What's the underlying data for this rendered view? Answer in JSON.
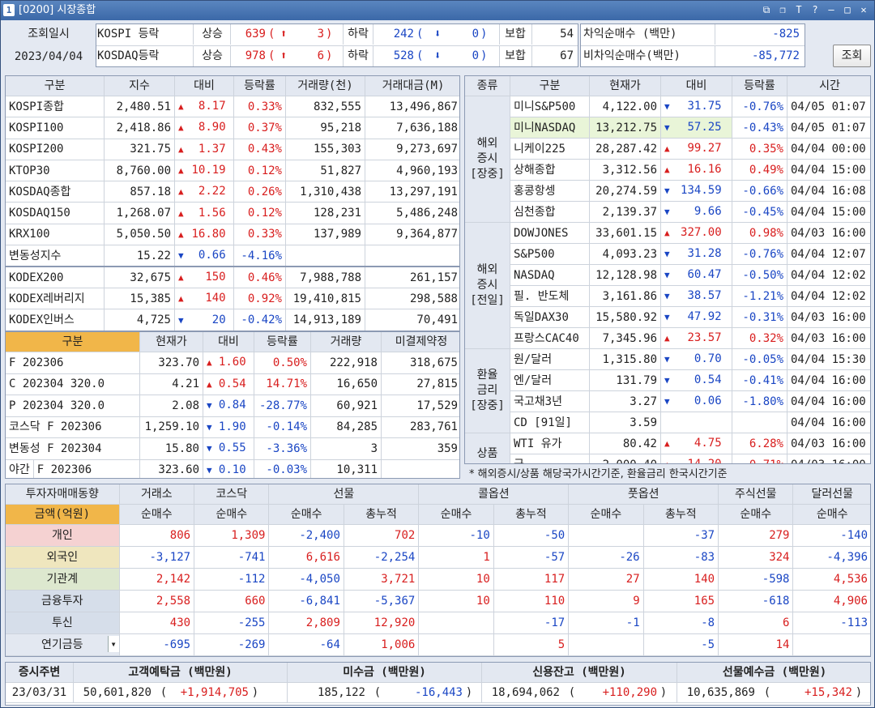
{
  "window": {
    "title": "[0200] 시장종합",
    "icon": "1"
  },
  "summary": {
    "date_label": "조회일시",
    "date": "2023/04/04",
    "kospi": {
      "label": "KOSPI 등락",
      "up_label": "상승",
      "up": "639",
      "upper": "3",
      "down_label": "하락",
      "down": "242",
      "lower": "0",
      "flat_label": "보합",
      "flat": "54"
    },
    "kosdaq": {
      "label": "KOSDAQ등락",
      "up_label": "상승",
      "up": "978",
      "upper": "6",
      "down_label": "하락",
      "down": "528",
      "lower": "0",
      "flat_label": "보합",
      "flat": "67"
    },
    "arb_label": "차익순매수  (백만)",
    "arb": "-825",
    "nonarb_label": "비차익순매수(백만)",
    "nonarb": "-85,772",
    "query_button": "조회"
  },
  "index_table": {
    "headers": [
      "구분",
      "지수",
      "대비",
      "등락률",
      "거래량(천)",
      "거래대금(M)"
    ],
    "rows": [
      {
        "name": "KOSPI종합",
        "value": "2,480.51",
        "dir": "up",
        "chg": "8.17",
        "rate": "0.33%",
        "vol": "832,555",
        "amt": "13,496,867"
      },
      {
        "name": "KOSPI100",
        "value": "2,418.86",
        "dir": "up",
        "chg": "8.90",
        "rate": "0.37%",
        "vol": "95,218",
        "amt": "7,636,188"
      },
      {
        "name": "KOSPI200",
        "value": "321.75",
        "dir": "up",
        "chg": "1.37",
        "rate": "0.43%",
        "vol": "155,303",
        "amt": "9,273,697"
      },
      {
        "name": "KTOP30",
        "value": "8,760.00",
        "dir": "up",
        "chg": "10.19",
        "rate": "0.12%",
        "vol": "51,827",
        "amt": "4,960,193"
      },
      {
        "name": "KOSDAQ종합",
        "value": "857.18",
        "dir": "up",
        "chg": "2.22",
        "rate": "0.26%",
        "vol": "1,310,438",
        "amt": "13,297,191"
      },
      {
        "name": "KOSDAQ150",
        "value": "1,268.07",
        "dir": "up",
        "chg": "1.56",
        "rate": "0.12%",
        "vol": "128,231",
        "amt": "5,486,248"
      },
      {
        "name": "KRX100",
        "value": "5,050.50",
        "dir": "up",
        "chg": "16.80",
        "rate": "0.33%",
        "vol": "137,989",
        "amt": "9,364,877"
      },
      {
        "name": "변동성지수",
        "value": "15.22",
        "dir": "down",
        "chg": "0.66",
        "rate": "-4.16%",
        "vol": "",
        "amt": ""
      },
      {
        "name": "KODEX200",
        "value": "32,675",
        "dir": "up",
        "chg": "150",
        "rate": "0.46%",
        "vol": "7,988,788",
        "amt": "261,157"
      },
      {
        "name": "KODEX레버리지",
        "value": "15,385",
        "dir": "up",
        "chg": "140",
        "rate": "0.92%",
        "vol": "19,410,815",
        "amt": "298,588"
      },
      {
        "name": "KODEX인버스",
        "value": "4,725",
        "dir": "down",
        "chg": "20",
        "rate": "-0.42%",
        "vol": "14,913,189",
        "amt": "70,491"
      }
    ]
  },
  "futures_table": {
    "headers": [
      "구분",
      "현재가",
      "대비",
      "등락률",
      "거래량",
      "미결제약정"
    ],
    "rows": [
      {
        "name": "F 202306",
        "value": "323.70",
        "dir": "up",
        "chg": "1.60",
        "rate": "0.50%",
        "vol": "222,918",
        "oi": "318,675"
      },
      {
        "name": "C 202304 320.0",
        "value": "4.21",
        "dir": "up",
        "chg": "0.54",
        "rate": "14.71%",
        "vol": "16,650",
        "oi": "27,815"
      },
      {
        "name": "P 202304 320.0",
        "value": "2.08",
        "dir": "down",
        "chg": "0.84",
        "rate": "-28.77%",
        "vol": "60,921",
        "oi": "17,529"
      },
      {
        "name": "코스닥 F 202306",
        "value": "1,259.10",
        "dir": "down",
        "chg": "1.90",
        "rate": "-0.14%",
        "vol": "84,285",
        "oi": "283,761"
      },
      {
        "name": "변동성 F 202304",
        "value": "15.80",
        "dir": "down",
        "chg": "0.55",
        "rate": "-3.36%",
        "vol": "3",
        "oi": "359"
      },
      {
        "name": "F 202306",
        "tag": "야간",
        "value": "323.60",
        "dir": "down",
        "chg": "0.10",
        "rate": "-0.03%",
        "vol": "10,311",
        "oi": ""
      }
    ]
  },
  "global_table": {
    "headers": [
      "종류",
      "구분",
      "현재가",
      "대비",
      "등락률",
      "시간"
    ],
    "groups": [
      {
        "label": "해외\n증시\n[장중]",
        "rows": [
          {
            "name": "미니S&P500",
            "value": "4,122.00",
            "dir": "down",
            "chg": "31.75",
            "rate": "-0.76%",
            "time": "04/05 01:07"
          },
          {
            "name": "미니NASDAQ",
            "value": "13,212.75",
            "dir": "down",
            "chg": "57.25",
            "rate": "-0.43%",
            "time": "04/05 01:07",
            "hl": true
          },
          {
            "name": "니케이225",
            "value": "28,287.42",
            "dir": "up",
            "chg": "99.27",
            "rate": "0.35%",
            "time": "04/04 00:00"
          },
          {
            "name": "상해종합",
            "value": "3,312.56",
            "dir": "up",
            "chg": "16.16",
            "rate": "0.49%",
            "time": "04/04 15:00"
          },
          {
            "name": "홍콩항셍",
            "value": "20,274.59",
            "dir": "down",
            "chg": "134.59",
            "rate": "-0.66%",
            "time": "04/04 16:08"
          },
          {
            "name": "심천종합",
            "value": "2,139.37",
            "dir": "down",
            "chg": "9.66",
            "rate": "-0.45%",
            "time": "04/04 15:00"
          }
        ]
      },
      {
        "label": "해외\n증시\n[전일]",
        "rows": [
          {
            "name": "DOWJONES",
            "value": "33,601.15",
            "dir": "up",
            "chg": "327.00",
            "rate": "0.98%",
            "time": "04/03 16:00"
          },
          {
            "name": "S&P500",
            "value": "4,093.23",
            "dir": "down",
            "chg": "31.28",
            "rate": "-0.76%",
            "time": "04/04 12:07"
          },
          {
            "name": "NASDAQ",
            "value": "12,128.98",
            "dir": "down",
            "chg": "60.47",
            "rate": "-0.50%",
            "time": "04/04 12:02"
          },
          {
            "name": "필. 반도체",
            "value": "3,161.86",
            "dir": "down",
            "chg": "38.57",
            "rate": "-1.21%",
            "time": "04/04 12:02"
          },
          {
            "name": "독일DAX30",
            "value": "15,580.92",
            "dir": "down",
            "chg": "47.92",
            "rate": "-0.31%",
            "time": "04/03 16:00"
          },
          {
            "name": "프랑스CAC40",
            "value": "7,345.96",
            "dir": "up",
            "chg": "23.57",
            "rate": "0.32%",
            "time": "04/03 16:00"
          }
        ]
      },
      {
        "label": "환율\n금리\n[장중]",
        "rows": [
          {
            "name": "원/달러",
            "value": "1,315.80",
            "dir": "down",
            "chg": "0.70",
            "rate": "-0.05%",
            "time": "04/04 15:30"
          },
          {
            "name": "엔/달러",
            "value": "131.79",
            "dir": "down",
            "chg": "0.54",
            "rate": "-0.41%",
            "time": "04/04 16:00"
          },
          {
            "name": "국고채3년",
            "value": "3.27",
            "dir": "down",
            "chg": "0.06",
            "rate": "-1.80%",
            "time": "04/04 16:00"
          },
          {
            "name": "CD [91일]",
            "value": "3.59",
            "dir": "",
            "chg": "",
            "rate": "",
            "time": "04/04 16:00"
          }
        ]
      },
      {
        "label": "상품",
        "rows": [
          {
            "name": "WTI 유가",
            "value": "80.42",
            "dir": "up",
            "chg": "4.75",
            "rate": "6.28%",
            "time": "04/03 16:00"
          },
          {
            "name": "금",
            "value": "2,000.40",
            "dir": "up",
            "chg": "14.20",
            "rate": "0.71%",
            "time": "04/03 16:00"
          }
        ]
      }
    ],
    "note": "* 해외증시/상품 해당국가시간기준, 환율금리 한국시간기준"
  },
  "investor_table": {
    "title": "투자자매매동향",
    "unit_label": "금액(억원)",
    "col_groups": [
      "거래소",
      "코스닥",
      "선물",
      "콜옵션",
      "풋옵션",
      "주식선물",
      "달러선물"
    ],
    "sub_headers": [
      "순매수",
      "순매수",
      "순매수",
      "총누적",
      "순매수",
      "총누적",
      "순매수",
      "총누적",
      "순매수",
      "순매수"
    ],
    "rows": [
      {
        "name": "개인",
        "bg": "#f5d2d2",
        "vals": [
          "806",
          "1,309",
          "-2,400",
          "702",
          "-10",
          "-50",
          "",
          "-37",
          "279",
          "-140"
        ]
      },
      {
        "name": "외국인",
        "bg": "#efe6be",
        "vals": [
          "-3,127",
          "-741",
          "6,616",
          "-2,254",
          "1",
          "-57",
          "-26",
          "-83",
          "324",
          "-4,396"
        ]
      },
      {
        "name": "기관계",
        "bg": "#dde8cf",
        "vals": [
          "2,142",
          "-112",
          "-4,050",
          "3,721",
          "10",
          "117",
          "27",
          "140",
          "-598",
          "4,536"
        ]
      },
      {
        "name": "금융투자",
        "bg": "#d6deea",
        "vals": [
          "2,558",
          "660",
          "-6,841",
          "-5,367",
          "10",
          "110",
          "9",
          "165",
          "-618",
          "4,906"
        ]
      },
      {
        "name": "투신",
        "bg": "#d6deea",
        "vals": [
          "430",
          "-255",
          "2,809",
          "12,920",
          "",
          "-17",
          "-1",
          "-8",
          "6",
          "-113"
        ]
      },
      {
        "name": "연기금등",
        "bg": "#e3e8f1",
        "vals": [
          "-695",
          "-269",
          "-64",
          "1,006",
          "",
          "5",
          "",
          "-5",
          "14",
          ""
        ],
        "dropdown": true
      }
    ]
  },
  "deposit_table": {
    "headers": [
      "증시주변",
      "고객예탁금 (백만원)",
      "미수금 (백만원)",
      "신용잔고 (백만원)",
      "선물예수금 (백만원)"
    ],
    "date": "23/03/31",
    "items": [
      {
        "value": "50,601,820",
        "chg": "+1,914,705",
        "dir": "up"
      },
      {
        "value": "185,122",
        "chg": "-16,443",
        "dir": "down"
      },
      {
        "value": "18,694,062",
        "chg": "+110,290",
        "dir": "up"
      },
      {
        "value": "10,635,869",
        "chg": "+15,342",
        "dir": "up"
      }
    ]
  }
}
